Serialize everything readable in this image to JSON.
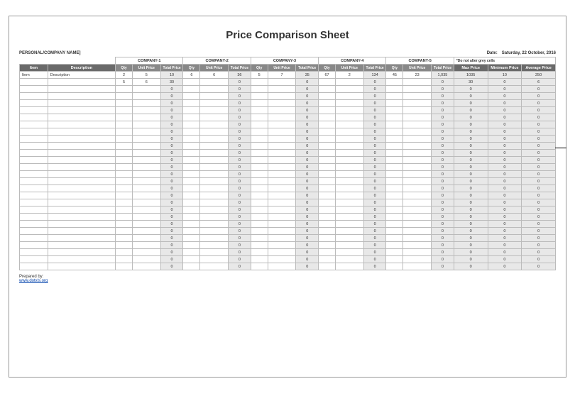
{
  "title": "Price Comparison Sheet",
  "meta": {
    "personal": "PERSONAL/COMPANY NAME]",
    "date_label": "Date:",
    "date_value": "Saturday, 22 October, 2016"
  },
  "group_headers": {
    "c1": "COMPANY-1",
    "c2": "COMPANY-2",
    "c3": "COMPANY-3",
    "c4": "COMPANY-4",
    "c5": "COMPANY-5",
    "note": "*Do not alter grey cells"
  },
  "col_headers": {
    "item": "Item",
    "desc": "Description",
    "qty": "Qty",
    "unit": "Unit Price",
    "total": "Total Price",
    "max": "Max Price",
    "min": "Minimum Price",
    "avg": "Average Price"
  },
  "rows": [
    {
      "item": "Item",
      "desc": "Description",
      "c1": {
        "qty": "2",
        "unit": "5",
        "total": "10"
      },
      "c2": {
        "qty": "6",
        "unit": "6",
        "total": "36"
      },
      "c3": {
        "qty": "5",
        "unit": "7",
        "total": "35"
      },
      "c4": {
        "qty": "67",
        "unit": "2",
        "total": "134"
      },
      "c5": {
        "qty": "45",
        "unit": "23",
        "total": "1,035"
      },
      "max": "1035",
      "min": "10",
      "avg": "250"
    },
    {
      "item": "",
      "desc": "",
      "c1": {
        "qty": "5",
        "unit": "6",
        "total": "30"
      },
      "c2": {
        "qty": "",
        "unit": "",
        "total": "0"
      },
      "c3": {
        "qty": "",
        "unit": "",
        "total": "0"
      },
      "c4": {
        "qty": "",
        "unit": "",
        "total": "0"
      },
      "c5": {
        "qty": "",
        "unit": "",
        "total": "0"
      },
      "max": "30",
      "min": "0",
      "avg": "6"
    },
    {
      "item": "",
      "desc": "",
      "c1": {
        "qty": "",
        "unit": "",
        "total": "0"
      },
      "c2": {
        "qty": "",
        "unit": "",
        "total": "0"
      },
      "c3": {
        "qty": "",
        "unit": "",
        "total": "0"
      },
      "c4": {
        "qty": "",
        "unit": "",
        "total": "0"
      },
      "c5": {
        "qty": "",
        "unit": "",
        "total": "0"
      },
      "max": "0",
      "min": "0",
      "avg": "0"
    },
    {
      "item": "",
      "desc": "",
      "c1": {
        "qty": "",
        "unit": "",
        "total": "0"
      },
      "c2": {
        "qty": "",
        "unit": "",
        "total": "0"
      },
      "c3": {
        "qty": "",
        "unit": "",
        "total": "0"
      },
      "c4": {
        "qty": "",
        "unit": "",
        "total": "0"
      },
      "c5": {
        "qty": "",
        "unit": "",
        "total": "0"
      },
      "max": "0",
      "min": "0",
      "avg": "0"
    },
    {
      "item": "",
      "desc": "",
      "c1": {
        "qty": "",
        "unit": "",
        "total": "0"
      },
      "c2": {
        "qty": "",
        "unit": "",
        "total": "0"
      },
      "c3": {
        "qty": "",
        "unit": "",
        "total": "0"
      },
      "c4": {
        "qty": "",
        "unit": "",
        "total": "0"
      },
      "c5": {
        "qty": "",
        "unit": "",
        "total": "0"
      },
      "max": "0",
      "min": "0",
      "avg": "0"
    },
    {
      "item": "",
      "desc": "",
      "c1": {
        "qty": "",
        "unit": "",
        "total": "0"
      },
      "c2": {
        "qty": "",
        "unit": "",
        "total": "0"
      },
      "c3": {
        "qty": "",
        "unit": "",
        "total": "0"
      },
      "c4": {
        "qty": "",
        "unit": "",
        "total": "0"
      },
      "c5": {
        "qty": "",
        "unit": "",
        "total": "0"
      },
      "max": "0",
      "min": "0",
      "avg": "0"
    },
    {
      "item": "",
      "desc": "",
      "c1": {
        "qty": "",
        "unit": "",
        "total": "0"
      },
      "c2": {
        "qty": "",
        "unit": "",
        "total": "0"
      },
      "c3": {
        "qty": "",
        "unit": "",
        "total": "0"
      },
      "c4": {
        "qty": "",
        "unit": "",
        "total": "0"
      },
      "c5": {
        "qty": "",
        "unit": "",
        "total": "0"
      },
      "max": "0",
      "min": "0",
      "avg": "0"
    },
    {
      "item": "",
      "desc": "",
      "c1": {
        "qty": "",
        "unit": "",
        "total": "0"
      },
      "c2": {
        "qty": "",
        "unit": "",
        "total": "0"
      },
      "c3": {
        "qty": "",
        "unit": "",
        "total": "0"
      },
      "c4": {
        "qty": "",
        "unit": "",
        "total": "0"
      },
      "c5": {
        "qty": "",
        "unit": "",
        "total": "0"
      },
      "max": "0",
      "min": "0",
      "avg": "0"
    },
    {
      "item": "",
      "desc": "",
      "c1": {
        "qty": "",
        "unit": "",
        "total": "0"
      },
      "c2": {
        "qty": "",
        "unit": "",
        "total": "0"
      },
      "c3": {
        "qty": "",
        "unit": "",
        "total": "0"
      },
      "c4": {
        "qty": "",
        "unit": "",
        "total": "0"
      },
      "c5": {
        "qty": "",
        "unit": "",
        "total": "0"
      },
      "max": "0",
      "min": "0",
      "avg": "0"
    },
    {
      "item": "",
      "desc": "",
      "c1": {
        "qty": "",
        "unit": "",
        "total": "0"
      },
      "c2": {
        "qty": "",
        "unit": "",
        "total": "0"
      },
      "c3": {
        "qty": "",
        "unit": "",
        "total": "0"
      },
      "c4": {
        "qty": "",
        "unit": "",
        "total": "0"
      },
      "c5": {
        "qty": "",
        "unit": "",
        "total": "0"
      },
      "max": "0",
      "min": "0",
      "avg": "0"
    },
    {
      "item": "",
      "desc": "",
      "c1": {
        "qty": "",
        "unit": "",
        "total": "0"
      },
      "c2": {
        "qty": "",
        "unit": "",
        "total": "0"
      },
      "c3": {
        "qty": "",
        "unit": "",
        "total": "0"
      },
      "c4": {
        "qty": "",
        "unit": "",
        "total": "0"
      },
      "c5": {
        "qty": "",
        "unit": "",
        "total": "0"
      },
      "max": "0",
      "min": "0",
      "avg": "0"
    },
    {
      "item": "",
      "desc": "",
      "c1": {
        "qty": "",
        "unit": "",
        "total": "0"
      },
      "c2": {
        "qty": "",
        "unit": "",
        "total": "0"
      },
      "c3": {
        "qty": "",
        "unit": "",
        "total": "0"
      },
      "c4": {
        "qty": "",
        "unit": "",
        "total": "0"
      },
      "c5": {
        "qty": "",
        "unit": "",
        "total": "0"
      },
      "max": "0",
      "min": "0",
      "avg": "0"
    },
    {
      "item": "",
      "desc": "",
      "c1": {
        "qty": "",
        "unit": "",
        "total": "0"
      },
      "c2": {
        "qty": "",
        "unit": "",
        "total": "0"
      },
      "c3": {
        "qty": "",
        "unit": "",
        "total": "0"
      },
      "c4": {
        "qty": "",
        "unit": "",
        "total": "0"
      },
      "c5": {
        "qty": "",
        "unit": "",
        "total": "0"
      },
      "max": "0",
      "min": "0",
      "avg": "0"
    },
    {
      "item": "",
      "desc": "",
      "c1": {
        "qty": "",
        "unit": "",
        "total": "0"
      },
      "c2": {
        "qty": "",
        "unit": "",
        "total": "0"
      },
      "c3": {
        "qty": "",
        "unit": "",
        "total": "0"
      },
      "c4": {
        "qty": "",
        "unit": "",
        "total": "0"
      },
      "c5": {
        "qty": "",
        "unit": "",
        "total": "0"
      },
      "max": "0",
      "min": "0",
      "avg": "0"
    },
    {
      "item": "",
      "desc": "",
      "c1": {
        "qty": "",
        "unit": "",
        "total": "0"
      },
      "c2": {
        "qty": "",
        "unit": "",
        "total": "0"
      },
      "c3": {
        "qty": "",
        "unit": "",
        "total": "0"
      },
      "c4": {
        "qty": "",
        "unit": "",
        "total": "0"
      },
      "c5": {
        "qty": "",
        "unit": "",
        "total": "0"
      },
      "max": "0",
      "min": "0",
      "avg": "0"
    },
    {
      "item": "",
      "desc": "",
      "c1": {
        "qty": "",
        "unit": "",
        "total": "0"
      },
      "c2": {
        "qty": "",
        "unit": "",
        "total": "0"
      },
      "c3": {
        "qty": "",
        "unit": "",
        "total": "0"
      },
      "c4": {
        "qty": "",
        "unit": "",
        "total": "0"
      },
      "c5": {
        "qty": "",
        "unit": "",
        "total": "0"
      },
      "max": "0",
      "min": "0",
      "avg": "0"
    },
    {
      "item": "",
      "desc": "",
      "c1": {
        "qty": "",
        "unit": "",
        "total": "0"
      },
      "c2": {
        "qty": "",
        "unit": "",
        "total": "0"
      },
      "c3": {
        "qty": "",
        "unit": "",
        "total": "0"
      },
      "c4": {
        "qty": "",
        "unit": "",
        "total": "0"
      },
      "c5": {
        "qty": "",
        "unit": "",
        "total": "0"
      },
      "max": "0",
      "min": "0",
      "avg": "0"
    },
    {
      "item": "",
      "desc": "",
      "c1": {
        "qty": "",
        "unit": "",
        "total": "0"
      },
      "c2": {
        "qty": "",
        "unit": "",
        "total": "0"
      },
      "c3": {
        "qty": "",
        "unit": "",
        "total": "0"
      },
      "c4": {
        "qty": "",
        "unit": "",
        "total": "0"
      },
      "c5": {
        "qty": "",
        "unit": "",
        "total": "0"
      },
      "max": "0",
      "min": "0",
      "avg": "0"
    },
    {
      "item": "",
      "desc": "",
      "c1": {
        "qty": "",
        "unit": "",
        "total": "0"
      },
      "c2": {
        "qty": "",
        "unit": "",
        "total": "0"
      },
      "c3": {
        "qty": "",
        "unit": "",
        "total": "0"
      },
      "c4": {
        "qty": "",
        "unit": "",
        "total": "0"
      },
      "c5": {
        "qty": "",
        "unit": "",
        "total": "0"
      },
      "max": "0",
      "min": "0",
      "avg": "0"
    },
    {
      "item": "",
      "desc": "",
      "c1": {
        "qty": "",
        "unit": "",
        "total": "0"
      },
      "c2": {
        "qty": "",
        "unit": "",
        "total": "0"
      },
      "c3": {
        "qty": "",
        "unit": "",
        "total": "0"
      },
      "c4": {
        "qty": "",
        "unit": "",
        "total": "0"
      },
      "c5": {
        "qty": "",
        "unit": "",
        "total": "0"
      },
      "max": "0",
      "min": "0",
      "avg": "0"
    },
    {
      "item": "",
      "desc": "",
      "c1": {
        "qty": "",
        "unit": "",
        "total": "0"
      },
      "c2": {
        "qty": "",
        "unit": "",
        "total": "0"
      },
      "c3": {
        "qty": "",
        "unit": "",
        "total": "0"
      },
      "c4": {
        "qty": "",
        "unit": "",
        "total": "0"
      },
      "c5": {
        "qty": "",
        "unit": "",
        "total": "0"
      },
      "max": "0",
      "min": "0",
      "avg": "0"
    },
    {
      "item": "",
      "desc": "",
      "c1": {
        "qty": "",
        "unit": "",
        "total": "0"
      },
      "c2": {
        "qty": "",
        "unit": "",
        "total": "0"
      },
      "c3": {
        "qty": "",
        "unit": "",
        "total": "0"
      },
      "c4": {
        "qty": "",
        "unit": "",
        "total": "0"
      },
      "c5": {
        "qty": "",
        "unit": "",
        "total": "0"
      },
      "max": "0",
      "min": "0",
      "avg": "0"
    },
    {
      "item": "",
      "desc": "",
      "c1": {
        "qty": "",
        "unit": "",
        "total": "0"
      },
      "c2": {
        "qty": "",
        "unit": "",
        "total": "0"
      },
      "c3": {
        "qty": "",
        "unit": "",
        "total": "0"
      },
      "c4": {
        "qty": "",
        "unit": "",
        "total": "0"
      },
      "c5": {
        "qty": "",
        "unit": "",
        "total": "0"
      },
      "max": "0",
      "min": "0",
      "avg": "0"
    },
    {
      "item": "",
      "desc": "",
      "c1": {
        "qty": "",
        "unit": "",
        "total": "0"
      },
      "c2": {
        "qty": "",
        "unit": "",
        "total": "0"
      },
      "c3": {
        "qty": "",
        "unit": "",
        "total": "0"
      },
      "c4": {
        "qty": "",
        "unit": "",
        "total": "0"
      },
      "c5": {
        "qty": "",
        "unit": "",
        "total": "0"
      },
      "max": "0",
      "min": "0",
      "avg": "0"
    },
    {
      "item": "",
      "desc": "",
      "c1": {
        "qty": "",
        "unit": "",
        "total": "0"
      },
      "c2": {
        "qty": "",
        "unit": "",
        "total": "0"
      },
      "c3": {
        "qty": "",
        "unit": "",
        "total": "0"
      },
      "c4": {
        "qty": "",
        "unit": "",
        "total": "0"
      },
      "c5": {
        "qty": "",
        "unit": "",
        "total": "0"
      },
      "max": "0",
      "min": "0",
      "avg": "0"
    },
    {
      "item": "",
      "desc": "",
      "c1": {
        "qty": "",
        "unit": "",
        "total": "0"
      },
      "c2": {
        "qty": "",
        "unit": "",
        "total": "0"
      },
      "c3": {
        "qty": "",
        "unit": "",
        "total": "0"
      },
      "c4": {
        "qty": "",
        "unit": "",
        "total": "0"
      },
      "c5": {
        "qty": "",
        "unit": "",
        "total": "0"
      },
      "max": "0",
      "min": "0",
      "avg": "0"
    },
    {
      "item": "",
      "desc": "",
      "c1": {
        "qty": "",
        "unit": "",
        "total": "0"
      },
      "c2": {
        "qty": "",
        "unit": "",
        "total": "0"
      },
      "c3": {
        "qty": "",
        "unit": "",
        "total": "0"
      },
      "c4": {
        "qty": "",
        "unit": "",
        "total": "0"
      },
      "c5": {
        "qty": "",
        "unit": "",
        "total": "0"
      },
      "max": "0",
      "min": "0",
      "avg": "0"
    },
    {
      "item": "",
      "desc": "",
      "c1": {
        "qty": "",
        "unit": "",
        "total": "0"
      },
      "c2": {
        "qty": "",
        "unit": "",
        "total": "0"
      },
      "c3": {
        "qty": "",
        "unit": "",
        "total": "0"
      },
      "c4": {
        "qty": "",
        "unit": "",
        "total": "0"
      },
      "c5": {
        "qty": "",
        "unit": "",
        "total": "0"
      },
      "max": "0",
      "min": "0",
      "avg": "0"
    }
  ],
  "footer": {
    "prepared": "Prepared by:",
    "link": "www.dotxls.org"
  }
}
